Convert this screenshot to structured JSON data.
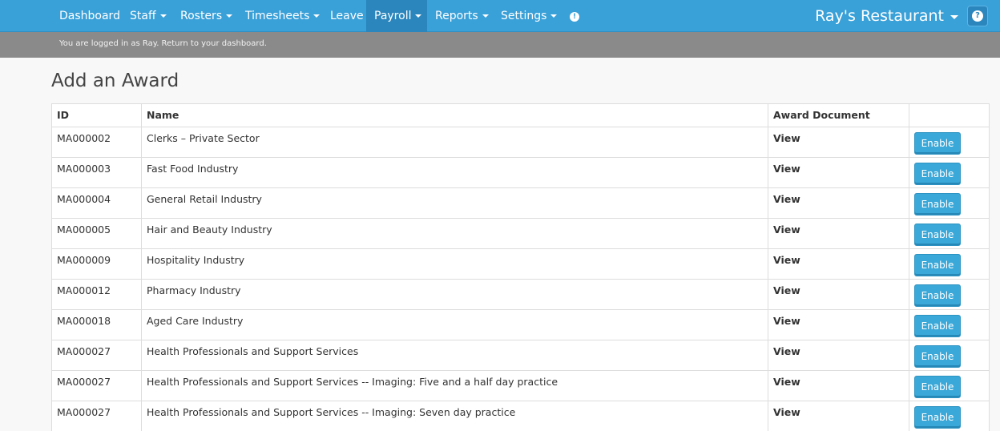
{
  "nav": {
    "items": [
      {
        "label": "Dashboard",
        "caret": false,
        "active": false
      },
      {
        "label": "Staff",
        "caret": true,
        "active": false
      },
      {
        "label": "Rosters",
        "caret": true,
        "active": false
      },
      {
        "label": "Timesheets",
        "caret": true,
        "active": false
      },
      {
        "label": "Leave",
        "caret": false,
        "active": false
      },
      {
        "label": "Payroll",
        "caret": true,
        "active": true
      },
      {
        "label": "Reports",
        "caret": true,
        "active": false
      },
      {
        "label": "Settings",
        "caret": true,
        "active": false
      }
    ],
    "info_icon": "info-icon",
    "brand": "Ray's Restaurant",
    "help_icon": "question-icon"
  },
  "subbar": {
    "text": "You are logged in as Ray. Return to your dashboard."
  },
  "page": {
    "title": "Add an Award"
  },
  "table": {
    "headers": {
      "id": "ID",
      "name": "Name",
      "document": "Award Document",
      "action": ""
    },
    "rows": [
      {
        "id": "MA000002",
        "name": "Clerks – Private Sector",
        "document": "View",
        "action": "Enable"
      },
      {
        "id": "MA000003",
        "name": "Fast Food Industry",
        "document": "View",
        "action": "Enable"
      },
      {
        "id": "MA000004",
        "name": "General Retail Industry",
        "document": "View",
        "action": "Enable"
      },
      {
        "id": "MA000005",
        "name": "Hair and Beauty Industry",
        "document": "View",
        "action": "Enable"
      },
      {
        "id": "MA000009",
        "name": "Hospitality Industry",
        "document": "View",
        "action": "Enable"
      },
      {
        "id": "MA000012",
        "name": "Pharmacy Industry",
        "document": "View",
        "action": "Enable"
      },
      {
        "id": "MA000018",
        "name": "Aged Care Industry",
        "document": "View",
        "action": "Enable"
      },
      {
        "id": "MA000027",
        "name": "Health Professionals and Support Services",
        "document": "View",
        "action": "Enable"
      },
      {
        "id": "MA000027",
        "name": "Health Professionals and Support Services -- Imaging: Five and a half day practice",
        "document": "View",
        "action": "Enable"
      },
      {
        "id": "MA000027",
        "name": "Health Professionals and Support Services -- Imaging: Seven day practice",
        "document": "View",
        "action": "Enable"
      }
    ]
  },
  "colors": {
    "nav_bg": "#3aa0d8",
    "nav_active": "#2a86bd",
    "subbar_bg": "#8a8a8a",
    "button_bg": "#3aa8d8"
  }
}
